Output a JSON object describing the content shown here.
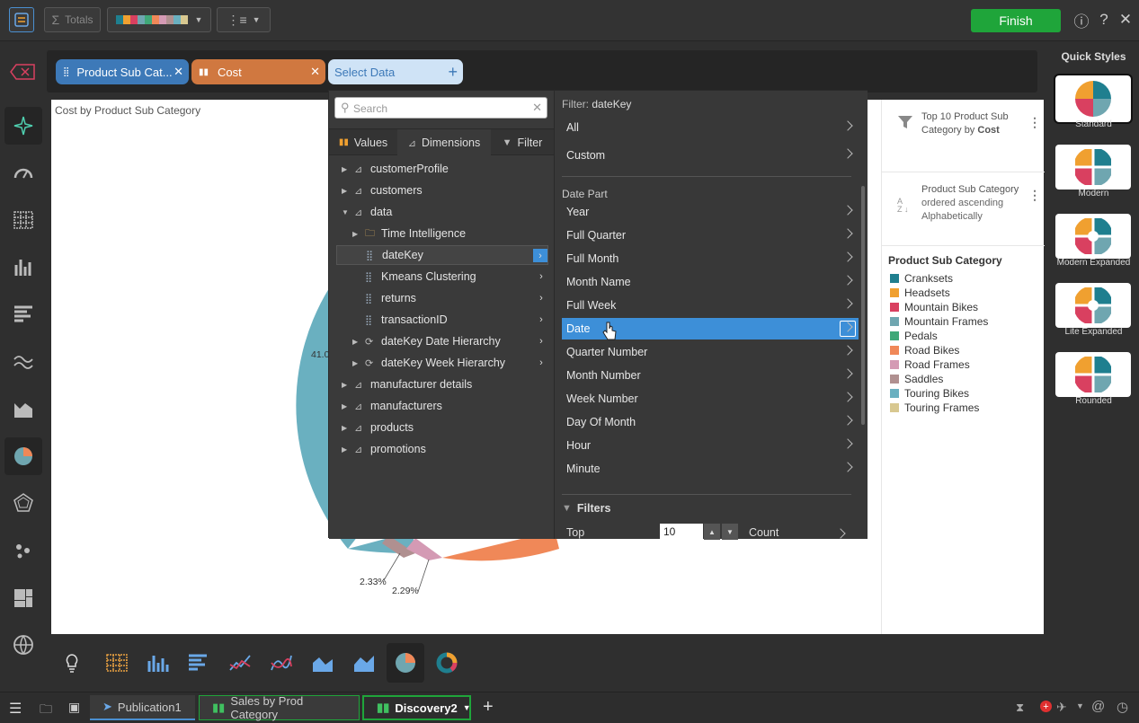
{
  "toolbar": {
    "totals_label": "Totals",
    "finish_label": "Finish"
  },
  "fields": {
    "chip1": "Product Sub Cat...",
    "chip2": "Cost",
    "chip3": "Select Data"
  },
  "chart": {
    "title": "Cost by Product Sub Category",
    "label_large": "41.0",
    "label_a": "2.33%",
    "label_b": "2.29%"
  },
  "picker": {
    "search_placeholder": "Search",
    "tabs": [
      "Values",
      "Dimensions",
      "Filter"
    ],
    "tree": [
      {
        "label": "customerProfile"
      },
      {
        "label": "customers"
      },
      {
        "label": "data"
      },
      {
        "label": "Time Intelligence"
      },
      {
        "label": "dateKey"
      },
      {
        "label": "Kmeans Clustering"
      },
      {
        "label": "returns"
      },
      {
        "label": "transactionID"
      },
      {
        "label": "dateKey Date Hierarchy"
      },
      {
        "label": "dateKey Week Hierarchy"
      },
      {
        "label": "manufacturer details"
      },
      {
        "label": "manufacturers"
      },
      {
        "label": "products"
      },
      {
        "label": "promotions"
      }
    ],
    "filter_heading_prefix": "Filter:",
    "filter_heading_field": "dateKey",
    "filter_items": [
      "All",
      "Custom"
    ],
    "date_part_heading": "Date Part",
    "date_parts": [
      "Year",
      "Full Quarter",
      "Full Month",
      "Month Name",
      "Full Week",
      "Date",
      "Quarter Number",
      "Month Number",
      "Week Number",
      "Day Of Month",
      "Hour",
      "Minute"
    ],
    "filters_heading": "Filters",
    "top_label": "Top",
    "top_value": "10",
    "count_label": "Count"
  },
  "side_info": {
    "filter_text_1": "Top 10 Product Sub Category by",
    "filter_text_bold": "Cost",
    "sort_text_bold": "Product Sub Category",
    "sort_text_rest": "ordered ascending Alphabetically"
  },
  "legend": {
    "title": "Product Sub Category",
    "items": [
      {
        "label": "Cranksets",
        "color": "#1f7f8f"
      },
      {
        "label": "Headsets",
        "color": "#f0a030"
      },
      {
        "label": "Mountain Bikes",
        "color": "#d94060"
      },
      {
        "label": "Mountain Frames",
        "color": "#6fa6b0"
      },
      {
        "label": "Pedals",
        "color": "#40a878"
      },
      {
        "label": "Road Bikes",
        "color": "#f08858"
      },
      {
        "label": "Road Frames",
        "color": "#d49ab4"
      },
      {
        "label": "Saddles",
        "color": "#b09090"
      },
      {
        "label": "Touring Bikes",
        "color": "#6ab0c0"
      },
      {
        "label": "Touring Frames",
        "color": "#d8c890"
      }
    ]
  },
  "quick_styles": {
    "title": "Quick Styles",
    "items": [
      "Standard",
      "Modern",
      "Modern Expanded",
      "Lite Expanded",
      "Rounded"
    ]
  },
  "bottom_tabs": [
    "Publication1",
    "Sales by Prod Category",
    "Discovery2"
  ]
}
